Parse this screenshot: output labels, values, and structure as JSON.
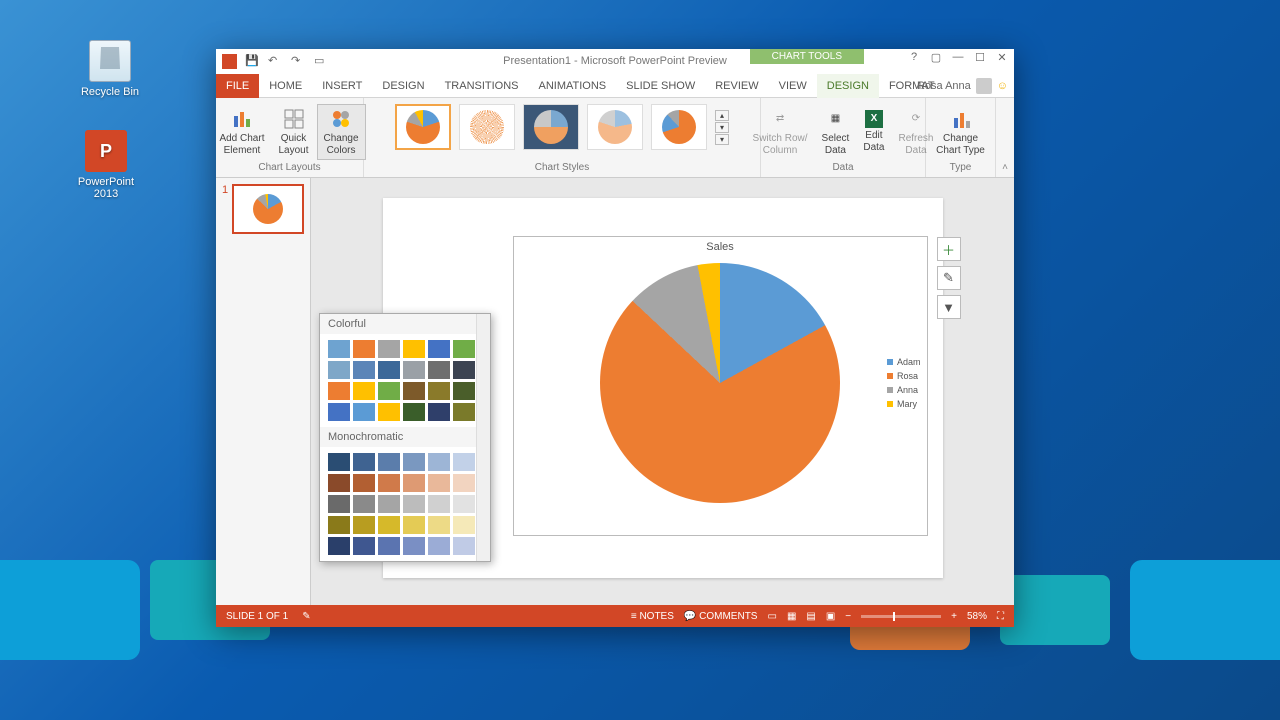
{
  "desktop": {
    "recycle_label": "Recycle Bin",
    "pptx_label": "PowerPoint 2013",
    "pptx_glyph": "P"
  },
  "window": {
    "title": "Presentation1 - Microsoft PowerPoint Preview",
    "chart_tools": "CHART TOOLS",
    "user": "Rosa Anna"
  },
  "tabs": {
    "file": "FILE",
    "home": "HOME",
    "insert": "INSERT",
    "design": "DESIGN",
    "transitions": "TRANSITIONS",
    "animations": "ANIMATIONS",
    "slideshow": "SLIDE SHOW",
    "review": "REVIEW",
    "view": "VIEW",
    "design2": "DESIGN",
    "format": "FORMAT"
  },
  "ribbon": {
    "add_chart_element": "Add Chart\nElement",
    "quick_layout": "Quick\nLayout",
    "change_colors": "Change\nColors",
    "chart_layouts": "Chart Layouts",
    "chart_styles": "Chart Styles",
    "switch_row": "Switch Row/\nColumn",
    "select_data": "Select\nData",
    "edit_data": "Edit\nData",
    "refresh_data": "Refresh\nData",
    "data": "Data",
    "change_chart_type": "Change\nChart Type",
    "type": "Type"
  },
  "color_dropdown": {
    "colorful": "Colorful",
    "monochromatic": "Monochromatic"
  },
  "slide_panel": {
    "thumb_number": "1"
  },
  "chart_data": {
    "type": "pie",
    "title": "Sales",
    "categories": [
      "Adam",
      "Rosa",
      "Anna",
      "Mary"
    ],
    "values": [
      17,
      70,
      10,
      3
    ],
    "colors": [
      "#5b9bd5",
      "#ed7d31",
      "#a5a5a5",
      "#ffc000"
    ]
  },
  "statusbar": {
    "slide_of": "SLIDE 1 OF 1",
    "notes": "NOTES",
    "comments": "COMMENTS",
    "zoom": "58%"
  },
  "palettes": {
    "colorful_rows": [
      [
        "#6ea3d0",
        "#ed7d31",
        "#a5a5a5",
        "#ffc000",
        "#4472c4",
        "#70ad47"
      ],
      [
        "#7ea7c8",
        "#5b85b8",
        "#3b6899",
        "#9aa0a6",
        "#6e6e6e",
        "#3c4452"
      ],
      [
        "#ed7d31",
        "#ffc000",
        "#70ad47",
        "#7d5a2a",
        "#8a7a2a",
        "#4a5e2a"
      ],
      [
        "#4472c4",
        "#5b9bd5",
        "#ffc000",
        "#3a5e2a",
        "#2f3f6a",
        "#7a7a2a"
      ]
    ],
    "mono_rows": [
      [
        "#2a4d73",
        "#3f6391",
        "#5b7dab",
        "#7a98c0",
        "#9db5d6",
        "#c2d1e8"
      ],
      [
        "#8a4a2a",
        "#b25f32",
        "#d07a4a",
        "#de9a73",
        "#e9b89a",
        "#f2d4c0"
      ],
      [
        "#6a6a6a",
        "#8a8a8a",
        "#a5a5a5",
        "#bcbcbc",
        "#d0d0d0",
        "#e2e2e2"
      ],
      [
        "#8a7a1a",
        "#b89d20",
        "#d6b92a",
        "#e4cb55",
        "#edda86",
        "#f5e9b8"
      ],
      [
        "#2a3f6a",
        "#3f5790",
        "#5b74b0",
        "#7a8fc4",
        "#9bacd6",
        "#c0cbe6"
      ]
    ]
  }
}
